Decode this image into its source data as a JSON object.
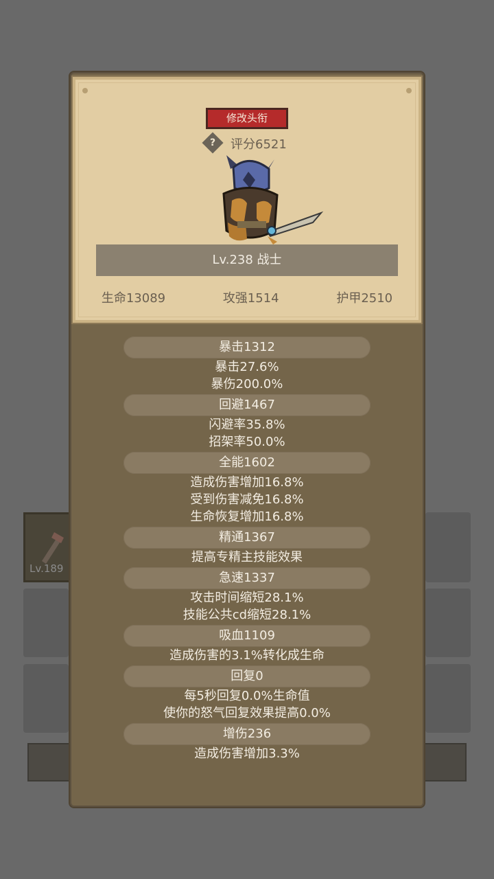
{
  "header": {
    "change_title_label": "修改头衔",
    "help_icon": "?",
    "score_text": "评分6521"
  },
  "hero": {
    "level_class": "Lv.238 战士",
    "hp": "生命13089",
    "attack": "攻强1514",
    "armor": "护甲2510"
  },
  "attributes": [
    {
      "header": "暴击1312",
      "lines": [
        "暴击27.6%",
        "暴伤200.0%"
      ]
    },
    {
      "header": "回避1467",
      "lines": [
        "闪避率35.8%",
        "招架率50.0%"
      ]
    },
    {
      "header": "全能1602",
      "lines": [
        "造成伤害增加16.8%",
        "受到伤害减免16.8%",
        "生命恢复增加16.8%"
      ]
    },
    {
      "header": "精通1367",
      "lines": [
        "提高专精主技能效果"
      ]
    },
    {
      "header": "急速1337",
      "lines": [
        "攻击时间缩短28.1%",
        "技能公共cd缩短28.1%"
      ]
    },
    {
      "header": "吸血1109",
      "lines": [
        "造成伤害的3.1%转化成生命"
      ]
    },
    {
      "header": "回复0",
      "lines": [
        "每5秒回复0.0%生命值",
        "使你的怒气回复效果提高0.0%"
      ]
    },
    {
      "header": "增伤236",
      "lines": [
        "造成伤害增加3.3%"
      ]
    }
  ],
  "background": {
    "item_level": "Lv.189"
  }
}
